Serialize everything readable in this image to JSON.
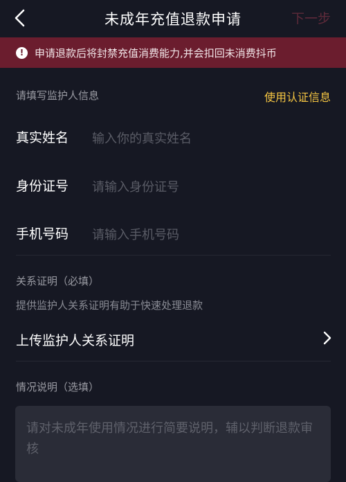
{
  "header": {
    "title": "未成年充值退款申请",
    "next_label": "下一步"
  },
  "banner": {
    "text": "申请退款后将封禁充值消费能力,并会扣回未消费抖币"
  },
  "guardian_section": {
    "label": "请填写监护人信息",
    "use_verified_link": "使用认证信息"
  },
  "fields": [
    {
      "label": "真实姓名",
      "placeholder": "输入你的真实姓名"
    },
    {
      "label": "身份证号",
      "placeholder": "请输入身份证号"
    },
    {
      "label": "手机号码",
      "placeholder": "请输入手机号码"
    }
  ],
  "relationship": {
    "label": "关系证明（必填）",
    "helper": "提供监护人关系证明有助于快速处理退款",
    "upload_label": "上传监护人关系证明"
  },
  "description": {
    "label": "情况说明（选填）",
    "placeholder": "请对未成年使用情况进行简要说明，辅以判断退款审核"
  },
  "colors": {
    "background": "#161823",
    "banner": "#6b1d2e",
    "accent_gold": "#f5c542",
    "next_disabled": "#5e2a3a"
  }
}
